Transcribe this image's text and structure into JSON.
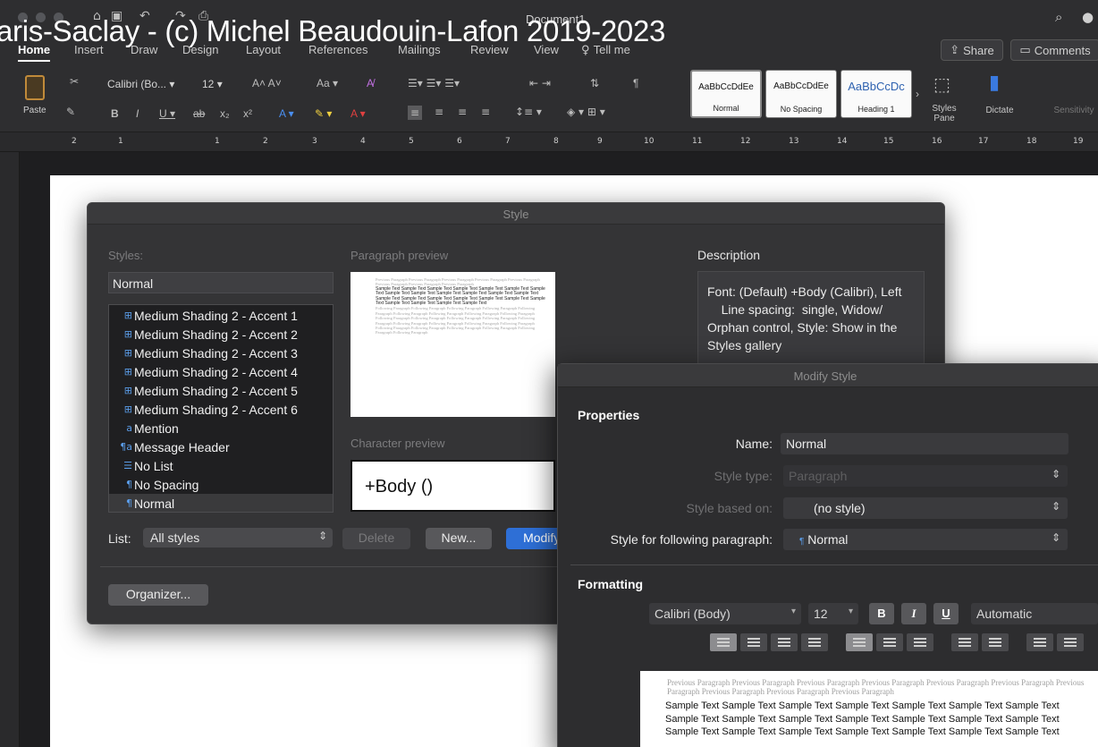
{
  "watermark": "aris-Saclay - (c) Michel Beaudouin-Lafon 2019-2023",
  "window": {
    "doc_title": "Document1"
  },
  "tabs": [
    "Home",
    "Insert",
    "Draw",
    "Design",
    "Layout",
    "References",
    "Mailings",
    "Review",
    "View",
    "Tell me"
  ],
  "header_buttons": {
    "share": "Share",
    "comments": "Comments"
  },
  "ribbon": {
    "paste": "Paste",
    "font_name": "Calibri (Bo...",
    "font_size": "12",
    "style_cards": [
      {
        "sample": "AaBbCcDdEe",
        "name": "Normal"
      },
      {
        "sample": "AaBbCcDdEe",
        "name": "No Spacing"
      },
      {
        "sample": "AaBbCcDc",
        "name": "Heading 1"
      }
    ],
    "styles_pane": "Styles Pane",
    "dictate": "Dictate",
    "sensitivity": "Sensitivity"
  },
  "ruler_ticks": [
    "2",
    "1",
    "1",
    "1",
    "2",
    "3",
    "4",
    "5",
    "6",
    "7",
    "8",
    "9",
    "10",
    "11",
    "12",
    "13",
    "14",
    "15",
    "16",
    "17",
    "18",
    "19"
  ],
  "style_dialog": {
    "title": "Style",
    "styles_label": "Styles:",
    "current_style": "Normal",
    "items": [
      {
        "icon": "table",
        "label": "Medium Shading 2 - Accent 1"
      },
      {
        "icon": "table",
        "label": "Medium Shading 2 - Accent 2"
      },
      {
        "icon": "table",
        "label": "Medium Shading 2 - Accent 3"
      },
      {
        "icon": "table",
        "label": "Medium Shading 2 - Accent 4"
      },
      {
        "icon": "table",
        "label": "Medium Shading 2 - Accent 5"
      },
      {
        "icon": "table",
        "label": "Medium Shading 2 - Accent 6"
      },
      {
        "icon": "char",
        "label": "Mention"
      },
      {
        "icon": "linked",
        "label": "Message Header"
      },
      {
        "icon": "list",
        "label": "No List"
      },
      {
        "icon": "para",
        "label": "No Spacing"
      },
      {
        "icon": "para",
        "label": "Normal"
      }
    ],
    "paragraph_preview_label": "Paragraph preview",
    "preview_previous": "Previous Paragraph Previous Paragraph Previous Paragraph Previous Paragraph Previous Paragraph Previous Paragraph Previous Paragraph Previous Paragraph",
    "preview_sample": "Sample Text Sample Text Sample Text Sample Text Sample Text Sample Text Sample Text Sample Text Sample Text Sample Text Sample Text Sample Text Sample Text Sample Text Sample Text Sample Text Sample Text Sample Text Sample Text Sample Text Sample Text Sample Text Sample Text Sample Text",
    "preview_following": "Following Paragraph Following Paragraph Following Paragraph Following Paragraph Following Paragraph Following Paragraph Following Paragraph Following Paragraph Following Paragraph Following Paragraph Following Paragraph Following Paragraph Following Paragraph Following Paragraph Following Paragraph Following Paragraph Following Paragraph Following Paragraph Following Paragraph Following Paragraph Following Paragraph Following Paragraph Following Paragraph Following Paragraph",
    "character_preview_label": "Character preview",
    "character_preview_text": "+Body ()",
    "description_label": "Description",
    "description_text": "Font: (Default) +Body (Calibri), Left\n    Line spacing:  single, Widow/ Orphan control, Style: Show in the Styles gallery",
    "list_label": "List:",
    "list_value": "All styles",
    "delete_button": "Delete",
    "new_button": "New...",
    "modify_button": "Modify...",
    "organizer_button": "Organizer..."
  },
  "modify_dialog": {
    "title": "Modify Style",
    "properties_heading": "Properties",
    "name_label": "Name:",
    "name_value": "Normal",
    "style_type_label": "Style type:",
    "style_type_value": "Paragraph",
    "based_on_label": "Style based on:",
    "based_on_value": "(no style)",
    "following_label": "Style for following paragraph:",
    "following_value": "Normal",
    "formatting_heading": "Formatting",
    "font_value": "Calibri (Body)",
    "size_value": "12",
    "bold": "B",
    "italic": "I",
    "underline": "U",
    "color_value": "Automatic",
    "preview_previous": "Previous Paragraph Previous Paragraph Previous Paragraph Previous Paragraph Previous Paragraph Previous Paragraph Previous Paragraph Previous Paragraph Previous Paragraph Previous Paragraph",
    "preview_sample": "Sample Text Sample Text Sample Text Sample Text Sample Text Sample Text Sample Text Sample Text Sample Text Sample Text Sample Text Sample Text Sample Text Sample Text Sample Text Sample Text Sample Text Sample Text Sample Text Sample Text Sample Text"
  },
  "colors": {
    "accent": "#2e6fd6",
    "dialog_bg": "#343436",
    "list_bg": "#1f1f21"
  }
}
